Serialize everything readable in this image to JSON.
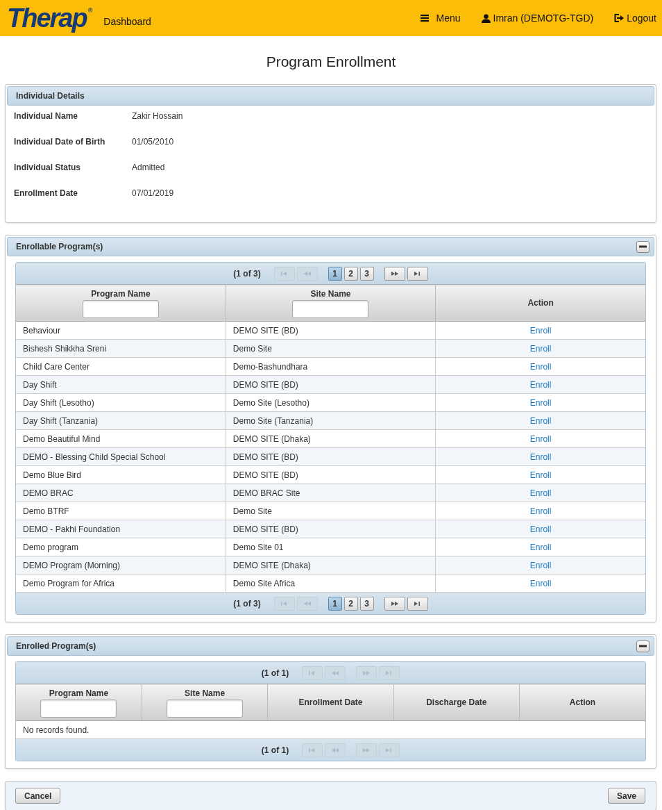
{
  "header": {
    "logo": "Therap",
    "logo_mark": "®",
    "dashboard": "Dashboard",
    "menu": "Menu",
    "user": "Imran (DEMOTG-TGD)",
    "logout": "Logout"
  },
  "page_title": "Program Enrollment",
  "details": {
    "title": "Individual Details",
    "fields": [
      {
        "label": "Individual Name",
        "value": "Zakir Hossain"
      },
      {
        "label": "Individual Date of Birth",
        "value": "01/05/2010"
      },
      {
        "label": "Individual Status",
        "value": "Admitted"
      },
      {
        "label": "Enrollment Date",
        "value": "07/01/2019"
      }
    ]
  },
  "enrollable": {
    "title": "Enrollable Program(s)",
    "expanded": true,
    "pager_top": {
      "summary": "(1 of 3)",
      "nav": [
        {
          "kind": "first",
          "disabled": true
        },
        {
          "kind": "prev",
          "disabled": true
        },
        {
          "kind": "next",
          "disabled": false
        },
        {
          "kind": "last",
          "disabled": false
        }
      ],
      "pages": [
        {
          "label": "1",
          "selected": true
        },
        {
          "label": "2",
          "selected": false
        },
        {
          "label": "3",
          "selected": false
        }
      ]
    },
    "columns": [
      {
        "label": "Program Name",
        "filter": true
      },
      {
        "label": "Site Name",
        "filter": true
      },
      {
        "label": "Action",
        "filter": false
      }
    ],
    "rows": [
      {
        "program": "Behaviour",
        "site": "DEMO SITE (BD)",
        "action": "Enroll"
      },
      {
        "program": "Bishesh Shikkha Sreni",
        "site": "Demo Site",
        "action": "Enroll"
      },
      {
        "program": "Child Care Center",
        "site": "Demo-Bashundhara",
        "action": "Enroll"
      },
      {
        "program": "Day Shift",
        "site": "DEMO SITE (BD)",
        "action": "Enroll"
      },
      {
        "program": "Day Shift (Lesotho)",
        "site": "Demo Site (Lesotho)",
        "action": "Enroll"
      },
      {
        "program": "Day Shift (Tanzania)",
        "site": "Demo Site (Tanzania)",
        "action": "Enroll"
      },
      {
        "program": "Demo Beautiful Mind",
        "site": "DEMO SITE (Dhaka)",
        "action": "Enroll"
      },
      {
        "program": "DEMO - Blessing Child Special School",
        "site": "DEMO SITE (BD)",
        "action": "Enroll"
      },
      {
        "program": "Demo Blue Bird",
        "site": "DEMO SITE (BD)",
        "action": "Enroll"
      },
      {
        "program": "DEMO BRAC",
        "site": "DEMO BRAC Site",
        "action": "Enroll"
      },
      {
        "program": "Demo BTRF",
        "site": "Demo Site",
        "action": "Enroll"
      },
      {
        "program": "DEMO - Pakhi Foundation",
        "site": "DEMO SITE (BD)",
        "action": "Enroll"
      },
      {
        "program": "Demo program",
        "site": "Demo Site 01",
        "action": "Enroll"
      },
      {
        "program": "DEMO Program (Morning)",
        "site": "DEMO SITE (Dhaka)",
        "action": "Enroll"
      },
      {
        "program": "Demo Program for Africa",
        "site": "Demo Site Africa",
        "action": "Enroll"
      }
    ],
    "pager_bottom": {
      "summary": "(1 of 3)",
      "nav": [
        {
          "kind": "first",
          "disabled": true
        },
        {
          "kind": "prev",
          "disabled": true
        },
        {
          "kind": "next",
          "disabled": false
        },
        {
          "kind": "last",
          "disabled": false
        }
      ],
      "pages": [
        {
          "label": "1",
          "selected": true
        },
        {
          "label": "2",
          "selected": false
        },
        {
          "label": "3",
          "selected": false
        }
      ]
    }
  },
  "enrolled": {
    "title": "Enrolled Program(s)",
    "expanded": true,
    "pager_top": {
      "summary": "(1 of 1)",
      "nav": [
        {
          "kind": "first",
          "disabled": true
        },
        {
          "kind": "prev",
          "disabled": true
        },
        {
          "kind": "next",
          "disabled": true
        },
        {
          "kind": "last",
          "disabled": true
        }
      ]
    },
    "columns": [
      {
        "label": "Program Name",
        "filter": true
      },
      {
        "label": "Site Name",
        "filter": true
      },
      {
        "label": "Enrollment Date",
        "filter": false
      },
      {
        "label": "Discharge Date",
        "filter": false
      },
      {
        "label": "Action",
        "filter": false
      }
    ],
    "empty": "No records found.",
    "pager_bottom": {
      "summary": "(1 of 1)",
      "nav": [
        {
          "kind": "first",
          "disabled": true
        },
        {
          "kind": "prev",
          "disabled": true
        },
        {
          "kind": "next",
          "disabled": true
        },
        {
          "kind": "last",
          "disabled": true
        }
      ]
    }
  },
  "buttons": {
    "cancel": "Cancel",
    "save": "Save"
  }
}
